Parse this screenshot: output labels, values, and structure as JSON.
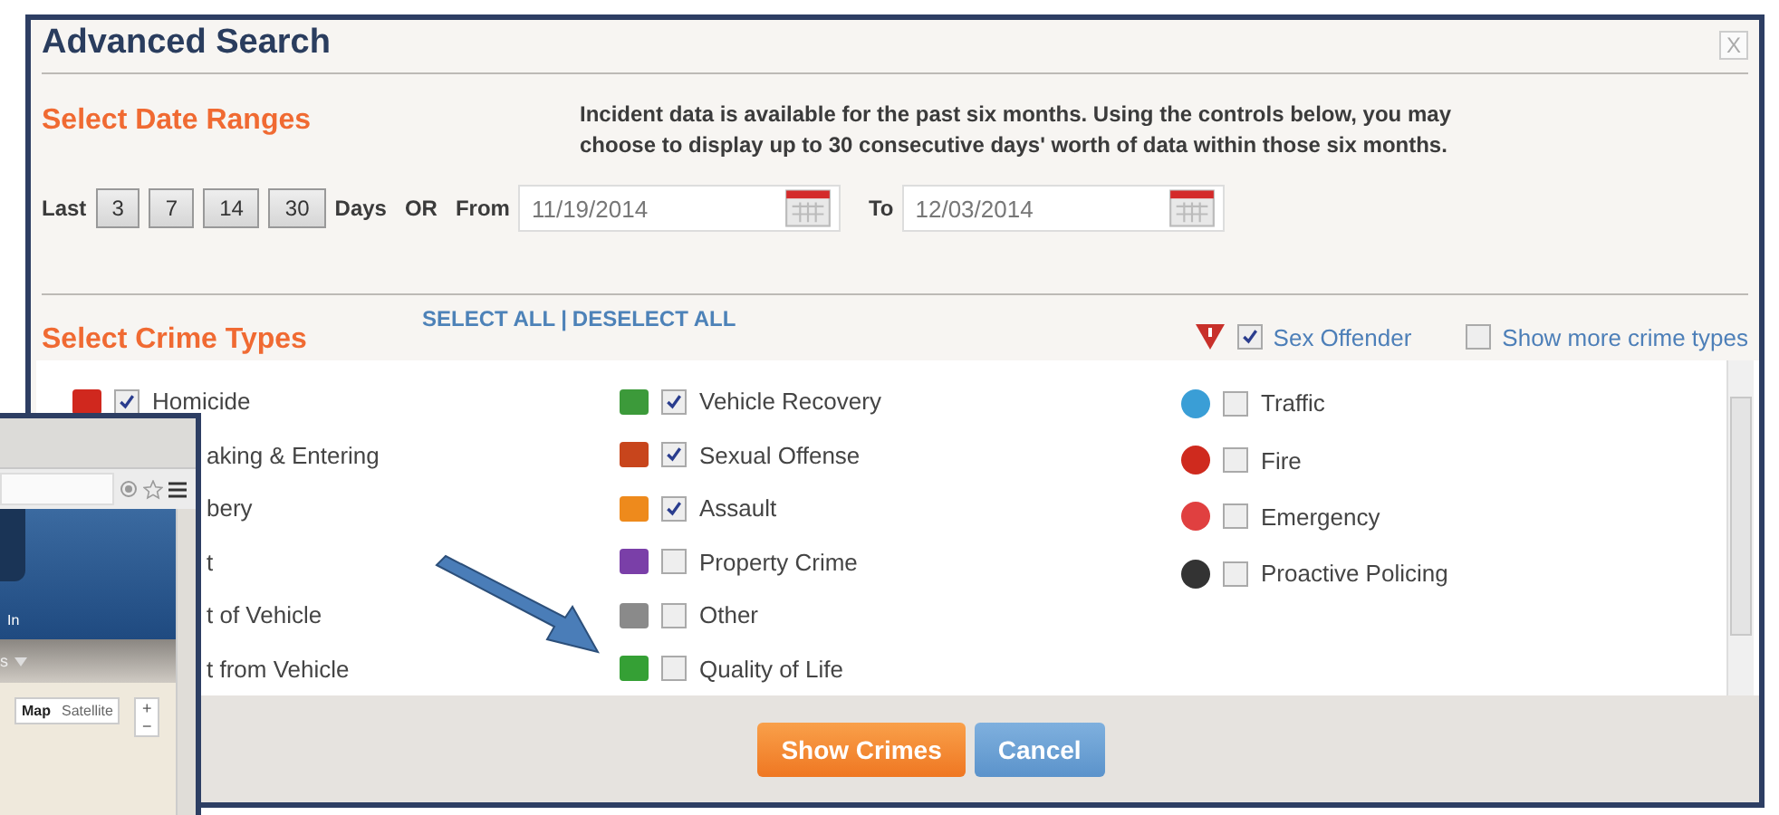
{
  "dialog": {
    "title": "Advanced Search",
    "close": "X"
  },
  "date_ranges": {
    "heading": "Select Date Ranges",
    "info": "Incident data is available for the past six months. Using the controls below, you may choose to display up to 30 consecutive days' worth of data within those six months.",
    "last_label": "Last",
    "day_buttons": [
      "3",
      "7",
      "14",
      "30"
    ],
    "days_label": "Days",
    "or_label": "OR",
    "from_label": "From",
    "from_value": "11/19/2014",
    "to_label": "To",
    "to_value": "12/03/2014"
  },
  "crime_types": {
    "heading": "Select Crime Types",
    "select_all": "SELECT ALL",
    "separator": "|",
    "deselect_all": "DESELECT ALL",
    "sex_offender": {
      "label": "Sex Offender",
      "checked": true
    },
    "show_more": {
      "label": "Show more crime types",
      "checked": false
    },
    "columns": [
      [
        {
          "kind": "full",
          "label": "Homicide",
          "checked": true,
          "color": "#d0281e"
        },
        {
          "kind": "clipped",
          "label": "aking & Entering"
        },
        {
          "kind": "clipped",
          "label": "bery"
        },
        {
          "kind": "clipped",
          "label": "t"
        },
        {
          "kind": "clipped",
          "label": "t of Vehicle"
        },
        {
          "kind": "clipped",
          "label": "t from Vehicle"
        }
      ],
      [
        {
          "kind": "full",
          "label": "Vehicle Recovery",
          "checked": true,
          "color": "#3c9a3a"
        },
        {
          "kind": "full",
          "label": "Sexual Offense",
          "checked": true,
          "color": "#c8451c"
        },
        {
          "kind": "full",
          "label": "Assault",
          "checked": true,
          "color": "#ee8a1c"
        },
        {
          "kind": "full",
          "label": "Property Crime",
          "checked": false,
          "color": "#7a3fa8"
        },
        {
          "kind": "full",
          "label": "Other",
          "checked": false,
          "color": "#8a8a8a"
        },
        {
          "kind": "full",
          "label": "Quality of Life",
          "checked": false,
          "color": "#35a035"
        }
      ],
      [
        {
          "kind": "full",
          "label": "Traffic",
          "checked": false,
          "color": "#3a9ed6"
        },
        {
          "kind": "full",
          "label": "Fire",
          "checked": false,
          "color": "#cf2a1e"
        },
        {
          "kind": "full",
          "label": "Emergency",
          "checked": false,
          "color": "#e04040"
        },
        {
          "kind": "full",
          "label": "Proactive Policing",
          "checked": false,
          "color": "#333333"
        }
      ]
    ]
  },
  "buttons": [
    {
      "label": "Show Crimes",
      "kind": "primary"
    },
    {
      "label": "Cancel",
      "kind": "secondary"
    }
  ],
  "browser_window": {
    "header_text": "In",
    "nav_text": "s",
    "map_buttons": [
      {
        "label": "Map",
        "selected": true
      },
      {
        "label": "Satellite",
        "selected": false
      }
    ],
    "zoom_buttons": [
      "+",
      "−"
    ]
  }
}
